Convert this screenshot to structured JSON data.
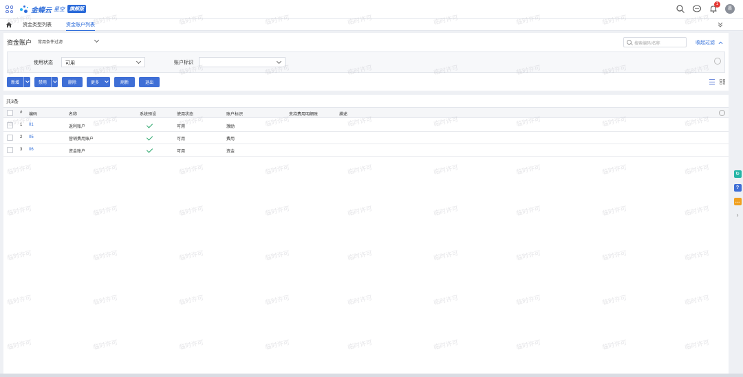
{
  "app": {
    "brand": "金蝶云",
    "brand_sub": "星空",
    "edition_badge": "旗舰版",
    "notification_count": "1",
    "avatar_initial": "晨"
  },
  "tabs": [
    {
      "label": "资金类型列表",
      "active": false
    },
    {
      "label": "资金账户列表",
      "active": true
    }
  ],
  "page": {
    "title": "资金账户",
    "common_filter": "常用条件过滤",
    "search_placeholder": "搜索编码/名称",
    "collapse_filter": "收起过滤"
  },
  "filters": {
    "status_label": "使用状态",
    "status_value": "可用",
    "account_tag_label": "账户标识",
    "account_tag_value": ""
  },
  "toolbar": {
    "new": "新增",
    "disable": "禁用",
    "delete": "删除",
    "more": "更多",
    "refresh": "刷新",
    "exit": "退出"
  },
  "table": {
    "total": "共3条",
    "columns": [
      "#",
      "编码",
      "名称",
      "系统预设",
      "使用状态",
      "账户标识",
      "支持费用明细账",
      "描述"
    ],
    "rows": [
      {
        "idx": "1",
        "code": "01",
        "name": "返利账户",
        "system_preset": true,
        "status": "可用",
        "tag": "激励",
        "fee_detail": "",
        "desc": ""
      },
      {
        "idx": "2",
        "code": "05",
        "name": "营销费用账户",
        "system_preset": true,
        "status": "可用",
        "tag": "费用",
        "fee_detail": "",
        "desc": ""
      },
      {
        "idx": "3",
        "code": "06",
        "name": "资金账户",
        "system_preset": true,
        "status": "可用",
        "tag": "资金",
        "fee_detail": "",
        "desc": ""
      }
    ]
  },
  "watermark_text": "临时许可",
  "colors": {
    "accent": "#2a6ad9",
    "button": "#3f6fd6",
    "check": "#2aa66b",
    "badge": "#e53935"
  },
  "side_float": [
    {
      "icon": "refresh-circle-icon",
      "color": "#26b5a6",
      "glyph": "↻"
    },
    {
      "icon": "help-icon",
      "color": "#3f6fd6",
      "glyph": "?"
    },
    {
      "icon": "chat-icon",
      "color": "#f0a020",
      "glyph": "…"
    }
  ]
}
